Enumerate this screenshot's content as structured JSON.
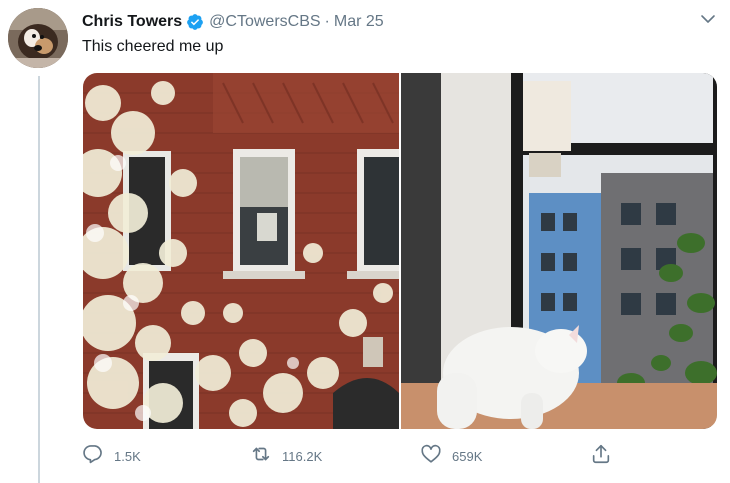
{
  "tweet": {
    "author_name": "Chris Towers",
    "handle": "@CTowersCBS",
    "separator": "·",
    "date": "Mar 25",
    "text": "This cheered me up",
    "verified": true
  },
  "actions": {
    "reply_count": "1.5K",
    "retweet_count": "116.2K",
    "like_count": "659K"
  },
  "icons": {
    "verified": "verified-badge-icon",
    "more": "chevron-down-icon",
    "reply": "reply-icon",
    "retweet": "retweet-icon",
    "like": "heart-icon",
    "share": "share-icon"
  },
  "colors": {
    "text_primary": "#14171a",
    "text_secondary": "#657786",
    "verified_blue": "#1da1f2",
    "thread_line": "#ccd6dd",
    "brick": "#8b3a2b"
  },
  "media": {
    "left_photo": "Brick building with blossoming tree and window sign",
    "right_photo": "White cat on windowsill looking out window"
  }
}
